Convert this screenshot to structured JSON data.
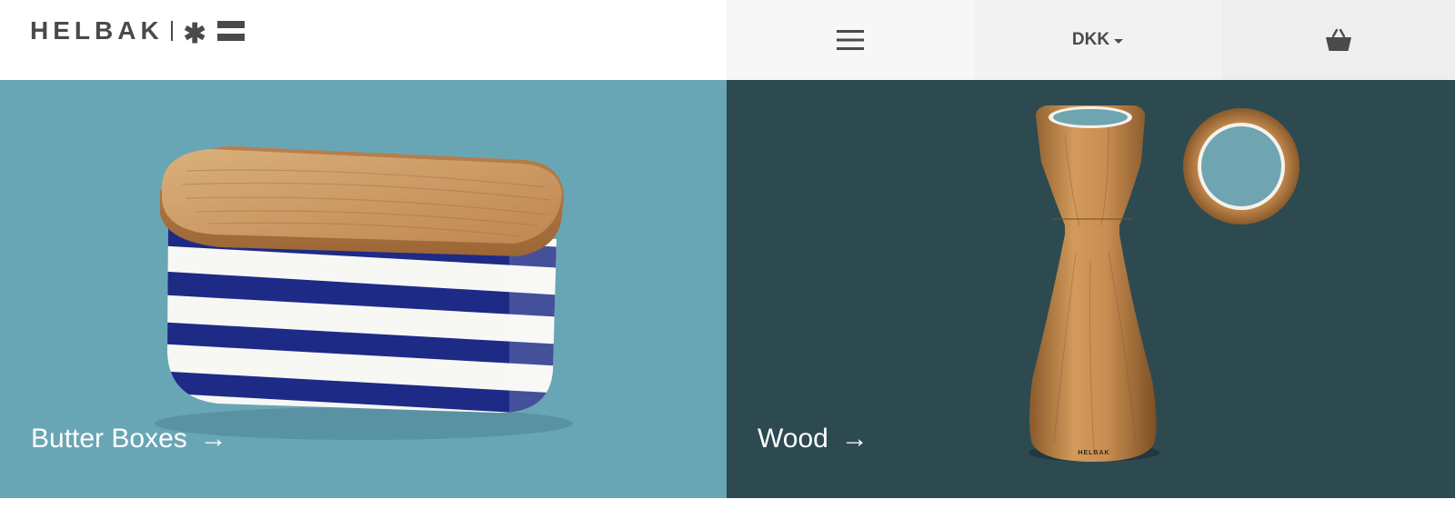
{
  "header": {
    "logo": {
      "wordmark": "HELBAK",
      "brand_color": "#4a4a4a"
    },
    "menu_icon": "hamburger-icon",
    "currency": {
      "selected": "DKK",
      "icon": "caret-down-icon"
    },
    "cart_icon": "basket-icon"
  },
  "tiles": [
    {
      "label": "Butter Boxes",
      "arrow": "→",
      "background": "#69a6b5"
    },
    {
      "label": "Wood",
      "arrow": "→",
      "background": "#2d4a50"
    }
  ],
  "colors": {
    "panel_blue": "#69a6b5",
    "panel_dark_teal": "#2d4a50",
    "stripe_navy": "#1d2a86",
    "oak": "#c99a62"
  }
}
